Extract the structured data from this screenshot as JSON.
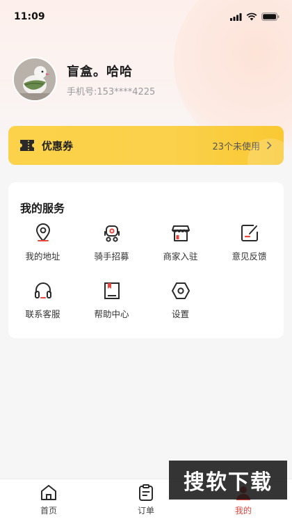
{
  "status_bar": {
    "time": "11:09"
  },
  "profile": {
    "name": "盲盒。哈哈",
    "phone": "手机号:153****4225"
  },
  "coupon": {
    "title": "优惠券",
    "count_text": "23个未使用"
  },
  "services": {
    "title": "我的服务",
    "items": [
      {
        "label": "我的地址",
        "icon": "location-pin-icon"
      },
      {
        "label": "骑手招募",
        "icon": "rider-scooter-icon"
      },
      {
        "label": "商家入驻",
        "icon": "store-icon"
      },
      {
        "label": "意见反馈",
        "icon": "feedback-edit-icon"
      },
      {
        "label": "联系客服",
        "icon": "headset-icon"
      },
      {
        "label": "帮助中心",
        "icon": "help-book-icon"
      },
      {
        "label": "设置",
        "icon": "settings-hexagon-icon"
      }
    ]
  },
  "tabbar": {
    "tabs": [
      {
        "label": "首页",
        "icon": "home-icon"
      },
      {
        "label": "订单",
        "icon": "order-clipboard-icon"
      },
      {
        "label": "我的",
        "icon": "profile-icon",
        "active": true
      }
    ]
  },
  "watermark": {
    "text": "搜软下载"
  },
  "colors": {
    "accent_red": "#e8453c",
    "coupon_yellow": "#fcd24a"
  }
}
